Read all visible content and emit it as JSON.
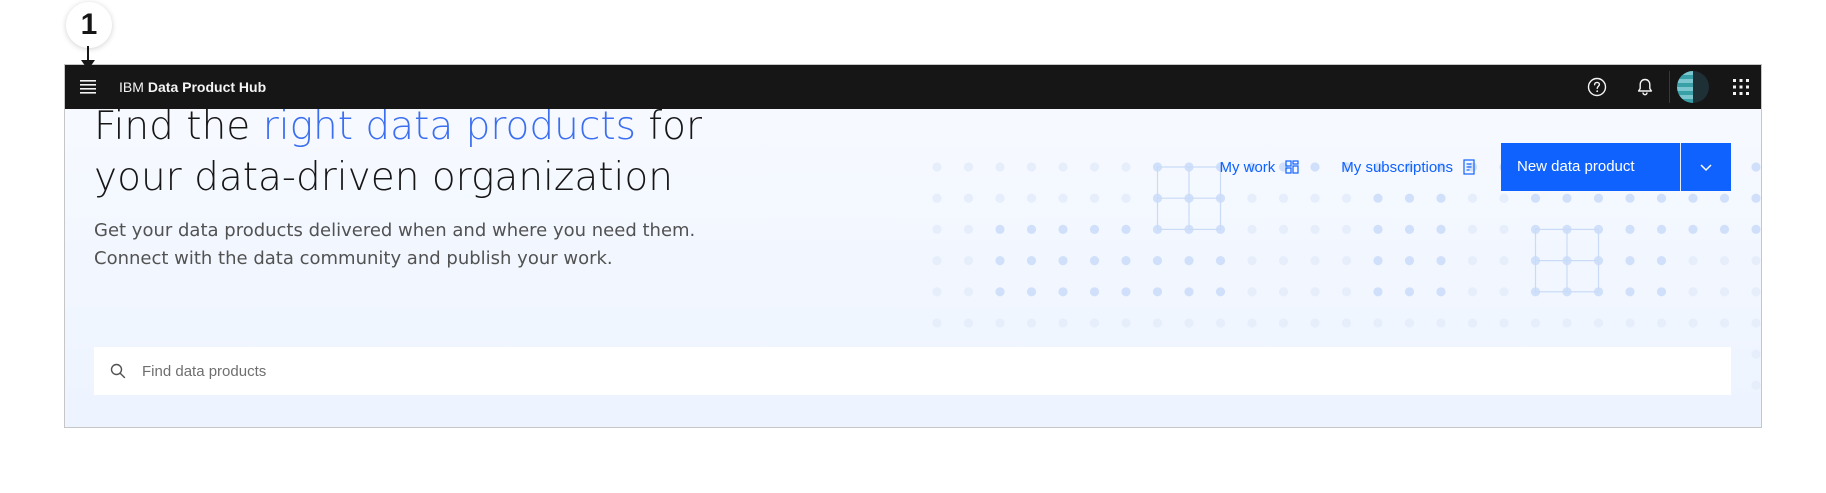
{
  "annotation": {
    "step_number": "1"
  },
  "header": {
    "brand_company": "IBM",
    "brand_product": "Data Product Hub",
    "icons": {
      "menu": "hamburger-menu-icon",
      "help": "help-icon",
      "notifications": "notification-bell-icon",
      "avatar": "user-avatar",
      "app_switcher": "app-switcher-icon"
    }
  },
  "hero": {
    "headline_part1": "Find the ",
    "headline_accent": "right data products",
    "headline_part2": " for your data-driven organization",
    "subtext_line1": "Get your data products delivered when and where you need them.",
    "subtext_line2": "Connect with the data community and publish your work."
  },
  "actions": {
    "my_work_label": "My work",
    "my_subscriptions_label": "My subscriptions",
    "new_product_label": "New data product"
  },
  "search": {
    "placeholder": "Find data products",
    "value": ""
  },
  "colors": {
    "accent": "#0f62fe",
    "headline_accent": "#3b6ff0",
    "topbar": "#161616"
  }
}
